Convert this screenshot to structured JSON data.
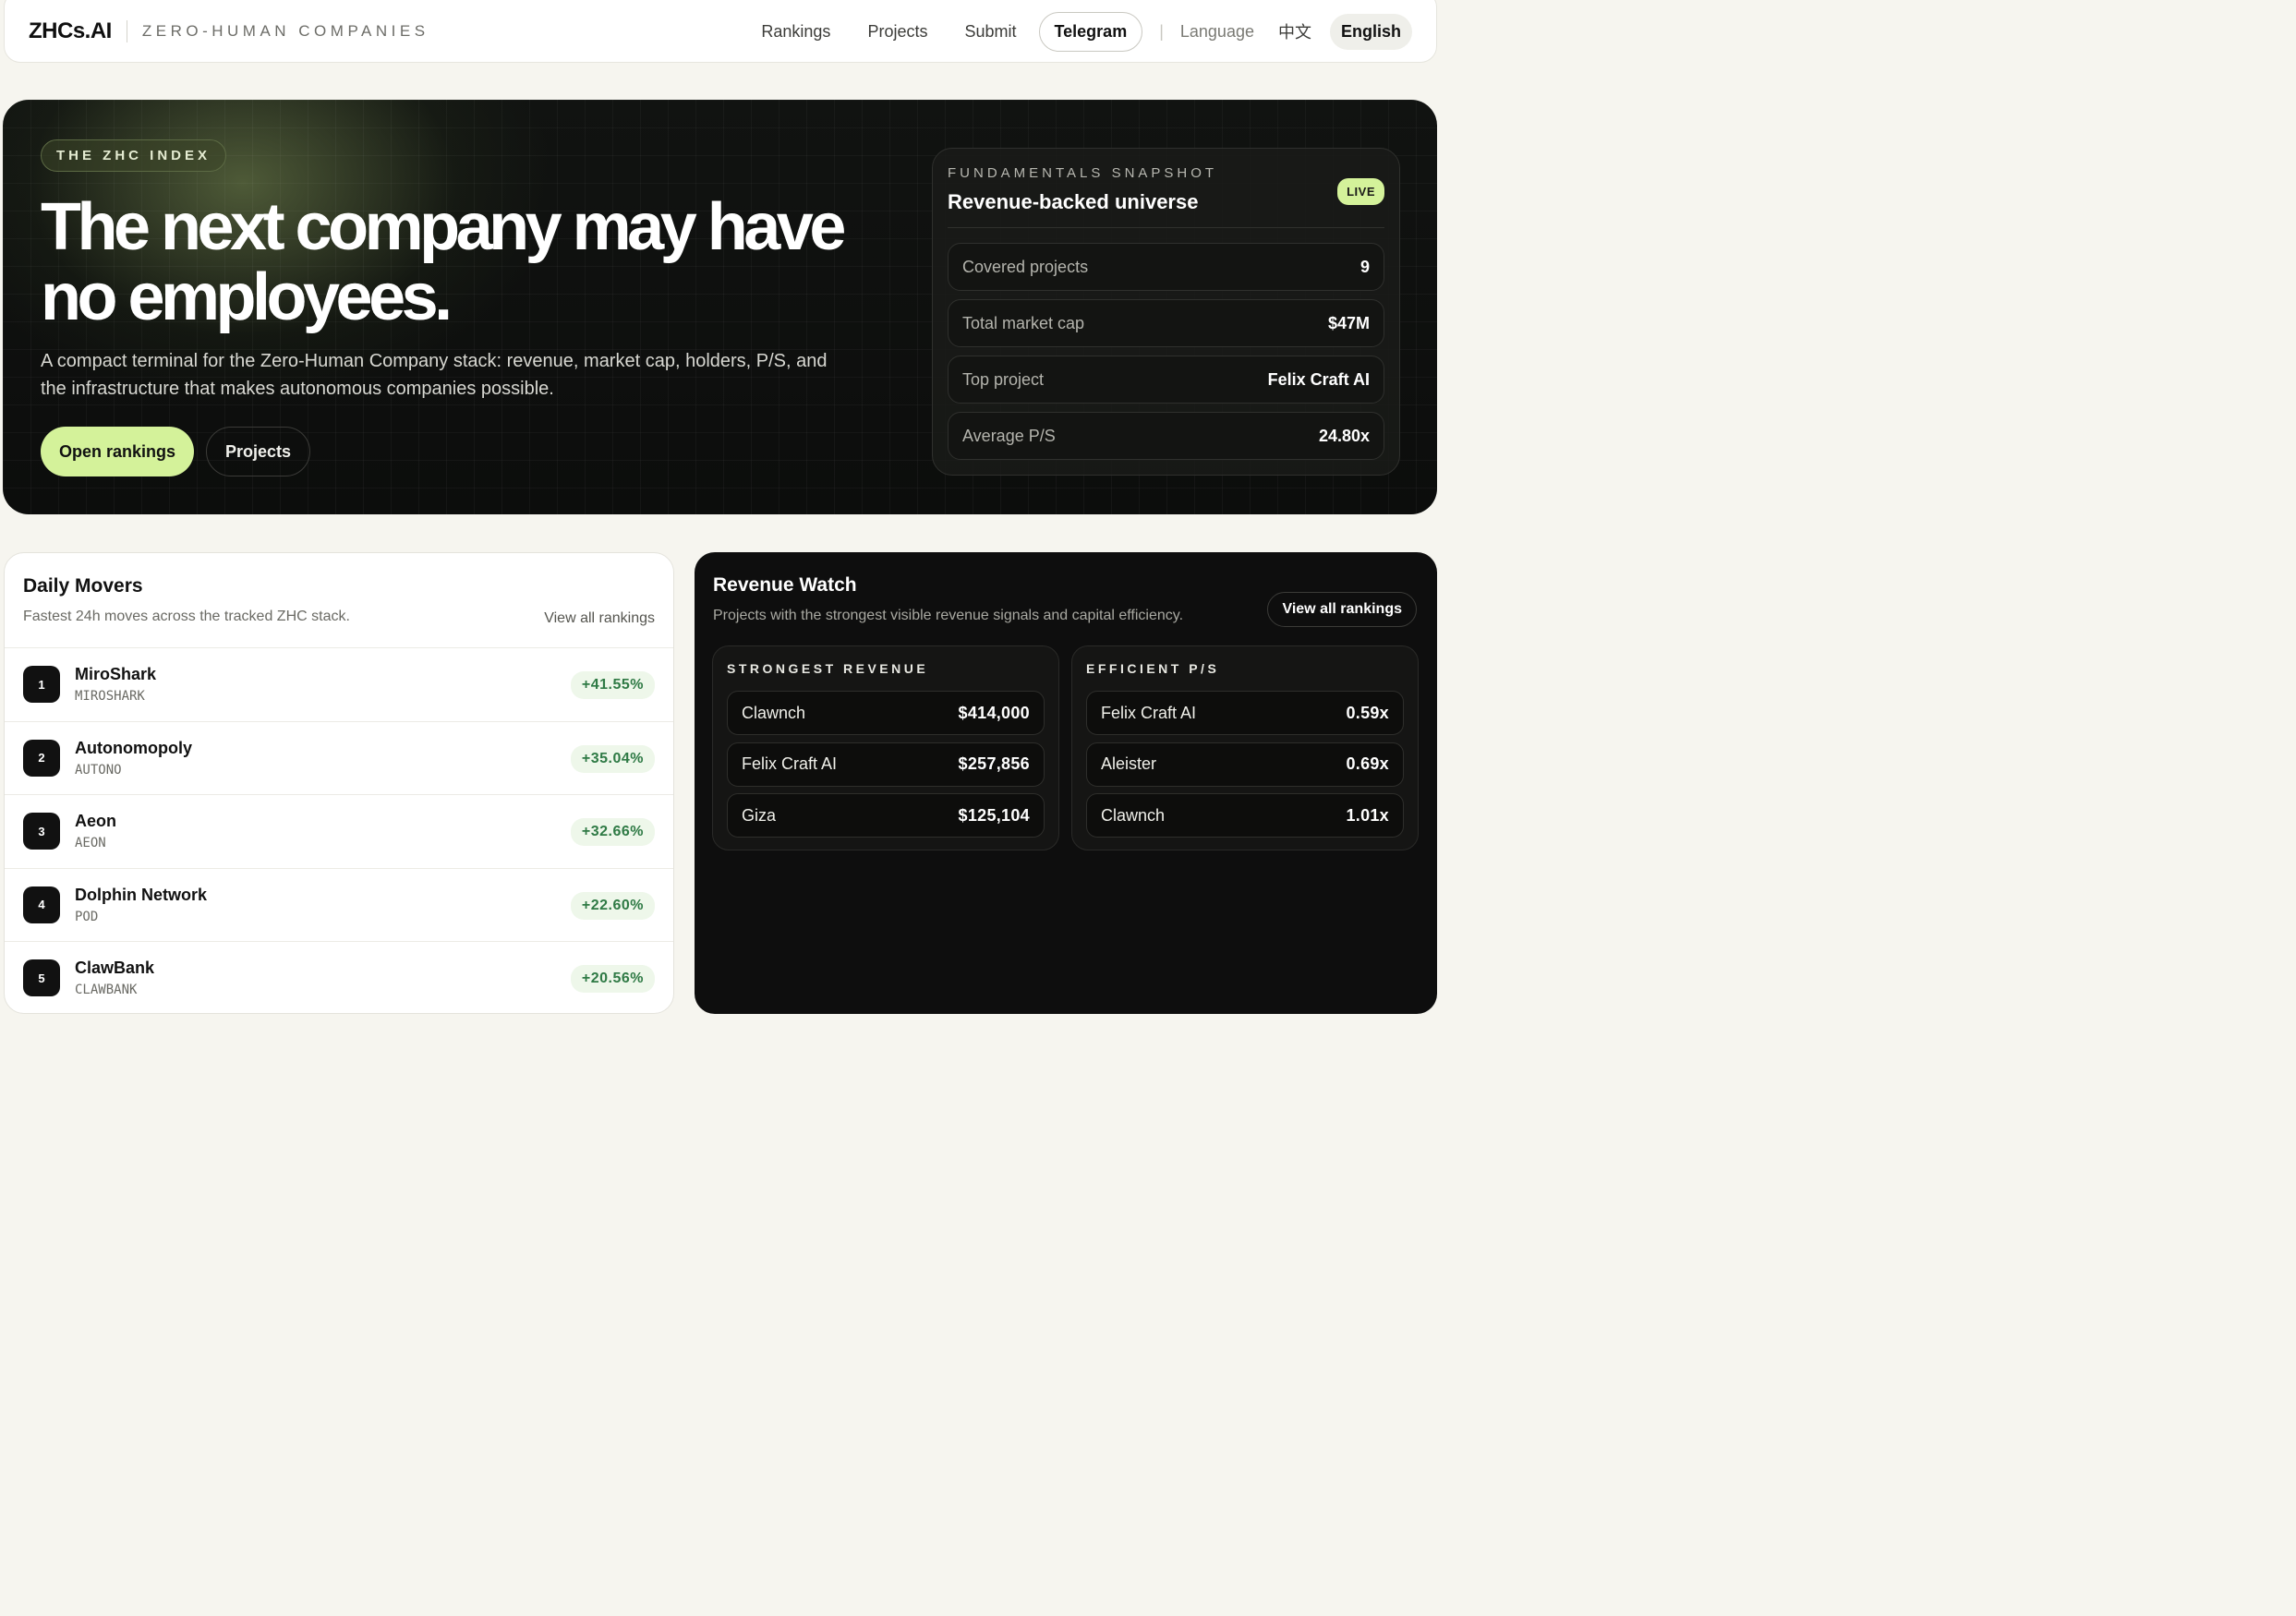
{
  "nav": {
    "logo": "ZHCs.AI",
    "tagline": "ZERO-HUMAN COMPANIES",
    "links": [
      "Rankings",
      "Projects",
      "Submit"
    ],
    "telegram": "Telegram",
    "divider": "|",
    "language_label": "Language",
    "lang_zh": "中文",
    "lang_en": "English"
  },
  "hero": {
    "badge": "THE ZHC INDEX",
    "title": "The next company may have no employees.",
    "description": "A compact terminal for the Zero-Human Company stack: revenue, market cap, holders, P/S, and the infrastructure that makes autonomous companies possible.",
    "primary_button": "Open rankings",
    "secondary_button": "Projects"
  },
  "snapshot": {
    "kicker": "FUNDAMENTALS SNAPSHOT",
    "title": "Revenue-backed universe",
    "live": "LIVE",
    "rows": [
      {
        "label": "Covered projects",
        "value": "9"
      },
      {
        "label": "Total market cap",
        "value": "$47M"
      },
      {
        "label": "Top project",
        "value": "Felix Craft AI"
      },
      {
        "label": "Average P/S",
        "value": "24.80x"
      }
    ]
  },
  "movers": {
    "title": "Daily Movers",
    "subtitle": "Fastest 24h moves across the tracked ZHC stack.",
    "link": "View all rankings",
    "items": [
      {
        "rank": "1",
        "name": "MiroShark",
        "ticker": "MIROSHARK",
        "change": "+41.55%"
      },
      {
        "rank": "2",
        "name": "Autonomopoly",
        "ticker": "AUTONO",
        "change": "+35.04%"
      },
      {
        "rank": "3",
        "name": "Aeon",
        "ticker": "AEON",
        "change": "+32.66%"
      },
      {
        "rank": "4",
        "name": "Dolphin Network",
        "ticker": "POD",
        "change": "+22.60%"
      },
      {
        "rank": "5",
        "name": "ClawBank",
        "ticker": "CLAWBANK",
        "change": "+20.56%"
      }
    ]
  },
  "watch": {
    "title": "Revenue Watch",
    "subtitle": "Projects with the strongest visible revenue signals and capital efficiency.",
    "link": "View all rankings",
    "strongest": {
      "kicker": "STRONGEST REVENUE",
      "rows": [
        {
          "name": "Clawnch",
          "value": "$414,000"
        },
        {
          "name": "Felix Craft AI",
          "value": "$257,856"
        },
        {
          "name": "Giza",
          "value": "$125,104"
        }
      ]
    },
    "efficient": {
      "kicker": "EFFICIENT P/S",
      "rows": [
        {
          "name": "Felix Craft AI",
          "value": "0.59x"
        },
        {
          "name": "Aleister",
          "value": "0.69x"
        },
        {
          "name": "Clawnch",
          "value": "1.01x"
        }
      ]
    }
  },
  "colors": {
    "accent": "#d4f29a",
    "positive": "#2f7a45",
    "dark_panel": "#0e0e0e"
  }
}
